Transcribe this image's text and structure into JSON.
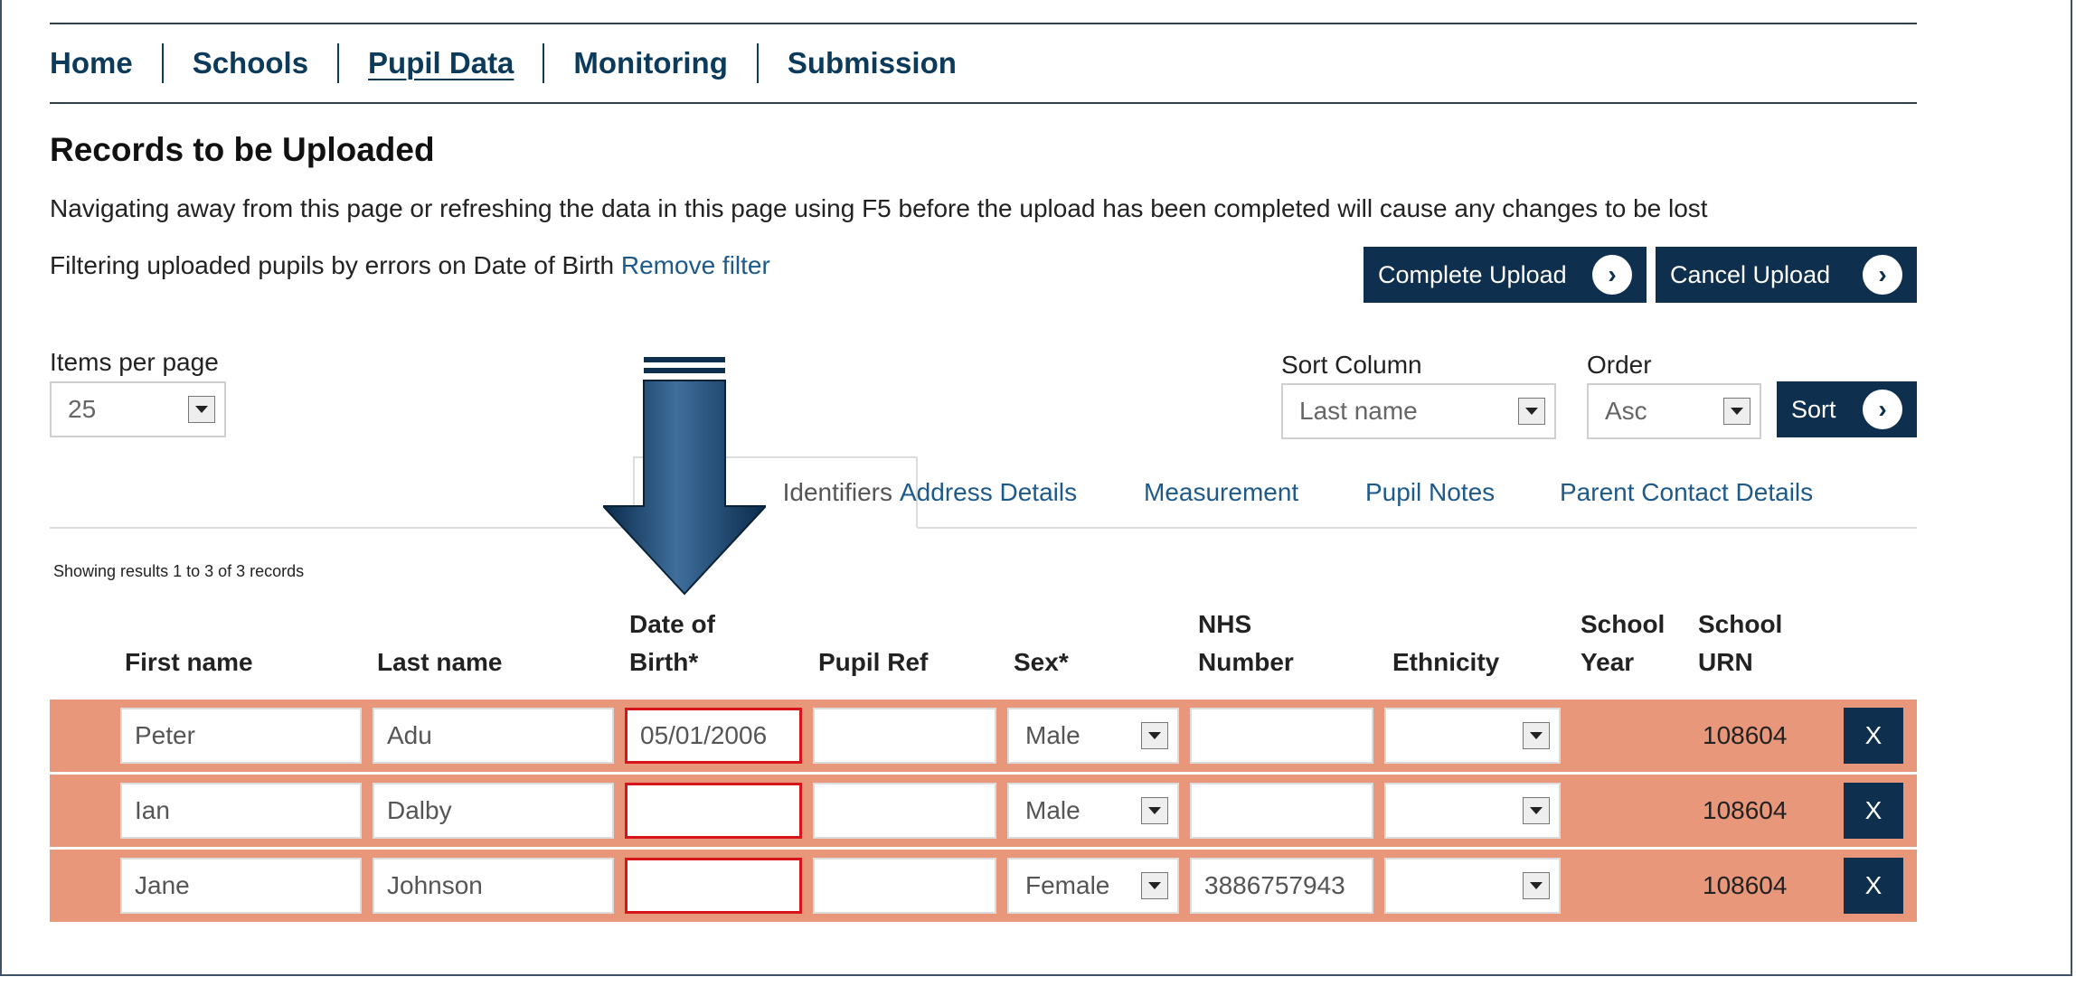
{
  "nav": {
    "items": [
      {
        "label": "Home",
        "active": false
      },
      {
        "label": "Schools",
        "active": false
      },
      {
        "label": "Pupil Data",
        "active": true
      },
      {
        "label": "Monitoring",
        "active": false
      },
      {
        "label": "Submission",
        "active": false
      }
    ]
  },
  "page": {
    "title": "Records to be Uploaded",
    "warning": "Navigating away from this page or refreshing the data in this page using F5 before the upload has been completed will cause any changes to be lost",
    "filter_text": "Filtering uploaded pupils by errors on Date of Birth",
    "remove_filter": "Remove filter"
  },
  "buttons": {
    "complete_upload": "Complete Upload",
    "cancel_upload": "Cancel Upload",
    "sort": "Sort"
  },
  "controls": {
    "items_per_page_label": "Items per page",
    "items_per_page_value": "25",
    "sort_column_label": "Sort Column",
    "sort_column_value": "Last name",
    "order_label": "Order",
    "order_value": "Asc"
  },
  "tabs": [
    {
      "label": "Identifiers",
      "active": true
    },
    {
      "label": "Address Details",
      "active": false
    },
    {
      "label": "Measurement",
      "active": false
    },
    {
      "label": "Pupil Notes",
      "active": false
    },
    {
      "label": "Parent Contact Details",
      "active": false
    }
  ],
  "results_text": "Showing results 1 to 3 of 3 records",
  "table": {
    "headers": {
      "first_name": "First name",
      "last_name": "Last name",
      "dob_line1": "Date of",
      "dob_line2": "Birth*",
      "pupil_ref": "Pupil Ref",
      "sex": "Sex*",
      "nhs_line1": "NHS",
      "nhs_line2": "Number",
      "ethnicity": "Ethnicity",
      "school_year_line1": "School",
      "school_year_line2": "Year",
      "school_urn_line1": "School",
      "school_urn_line2": "URN"
    },
    "rows": [
      {
        "first_name": "Peter",
        "last_name": "Adu",
        "dob": "05/01/2006",
        "pupil_ref": "",
        "sex": "Male",
        "nhs": "",
        "ethnicity": "",
        "urn": "108604",
        "delete": "X"
      },
      {
        "first_name": "Ian",
        "last_name": "Dalby",
        "dob": "",
        "pupil_ref": "",
        "sex": "Male",
        "nhs": "",
        "ethnicity": "",
        "urn": "108604",
        "delete": "X"
      },
      {
        "first_name": "Jane",
        "last_name": "Johnson",
        "dob": "",
        "pupil_ref": "",
        "sex": "Female",
        "nhs": "3886757943",
        "ethnicity": "",
        "urn": "108604",
        "delete": "X"
      }
    ]
  },
  "colors": {
    "nav_text": "#0b3a5b",
    "button_bg": "#0e2f4d",
    "row_bg": "#e9977a",
    "error_border": "#d8141b",
    "link": "#1d5a8a"
  },
  "icons": {
    "button_arrow": "chevron-right-circle-icon",
    "select_arrow": "dropdown-arrow-icon",
    "annotation": "down-arrow-icon"
  }
}
